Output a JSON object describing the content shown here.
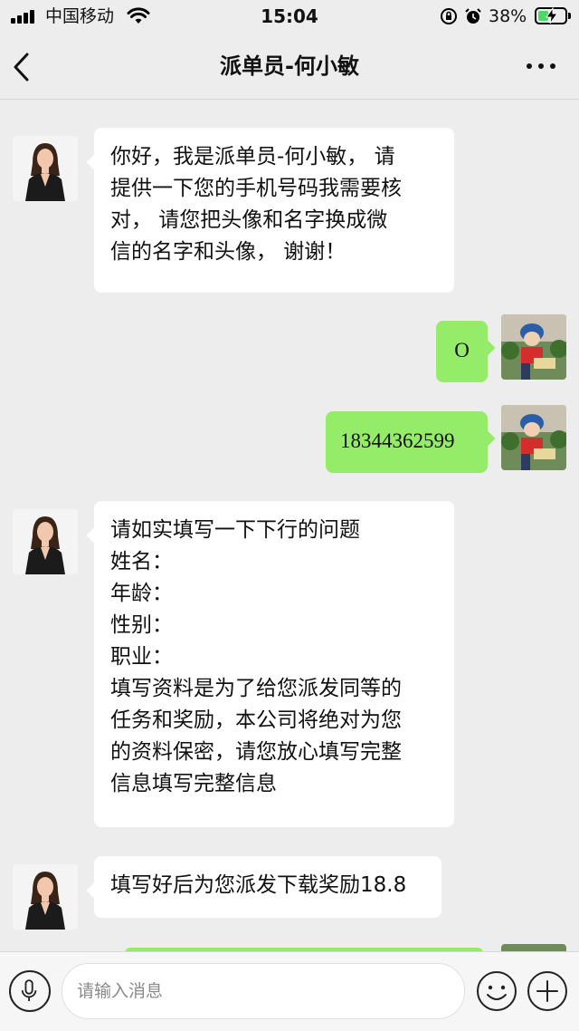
{
  "status_bar": {
    "carrier": "中国移动",
    "time": "15:04",
    "battery_percent": "38%",
    "battery_level": 0.38
  },
  "nav": {
    "title": "派单员-何小敏"
  },
  "messages": [
    {
      "side": "left",
      "lines": [
        "你好，我是派单员-何小敏， 请",
        "提供一下您的手机号码我需要核",
        "对， 请您把头像和名字换成微",
        "信的名字和头像， 谢谢！"
      ]
    },
    {
      "side": "right",
      "lines": [
        "O"
      ]
    },
    {
      "side": "right",
      "lines": [
        "18344362599"
      ]
    },
    {
      "side": "left",
      "lines": [
        "请如实填写一下下行的问题",
        "姓名：",
        "年龄：",
        "性别：",
        "职业：",
        "填写资料是为了给您派发同等的",
        "任务和奖励，本公司将绝对为您",
        "的资料保密，请您放心填写完整",
        "信息填写完整信息"
      ]
    },
    {
      "side": "left",
      "lines": [
        "填写好后为您派发下载奖励18.8"
      ]
    }
  ],
  "input_bar": {
    "placeholder": "请输入消息"
  },
  "icons": {
    "back": "chevron-left-icon",
    "more": "more-icon",
    "voice": "microphone-icon",
    "emoji": "smiley-icon",
    "plus": "plus-icon"
  }
}
